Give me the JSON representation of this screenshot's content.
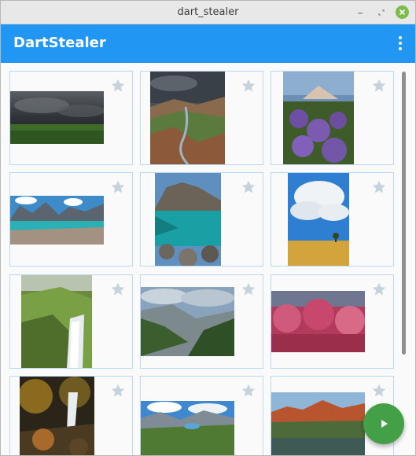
{
  "window": {
    "title": "dart_stealer",
    "minimize_icon": "minimize-icon",
    "maximize_icon": "maximize-icon",
    "close_icon": "close-icon"
  },
  "appbar": {
    "title": "DartStealer",
    "menu_icon": "more-vert-icon",
    "color": "#2196f3"
  },
  "gallery": {
    "star_icon": "star-outline-icon",
    "items": [
      {
        "subject": "storm-clouds-field"
      },
      {
        "subject": "mountain-river-valley"
      },
      {
        "subject": "purple-wildflowers-mountain"
      },
      {
        "subject": "alpine-lake-reflection"
      },
      {
        "subject": "mountain-lake-rocks"
      },
      {
        "subject": "clouds-over-wheat-field"
      },
      {
        "subject": "waterfall-green-hills"
      },
      {
        "subject": "forested-mountain-valley"
      },
      {
        "subject": "pink-blossom-trees"
      },
      {
        "subject": "forest-waterfall-autumn"
      },
      {
        "subject": "mountain-lake-meadow"
      },
      {
        "subject": "red-cliffs-lake"
      }
    ]
  },
  "fab": {
    "icon": "play-icon",
    "color": "#43a047"
  },
  "colors": {
    "card_border": "#bcd8f2",
    "star": "#c7d3dc"
  }
}
